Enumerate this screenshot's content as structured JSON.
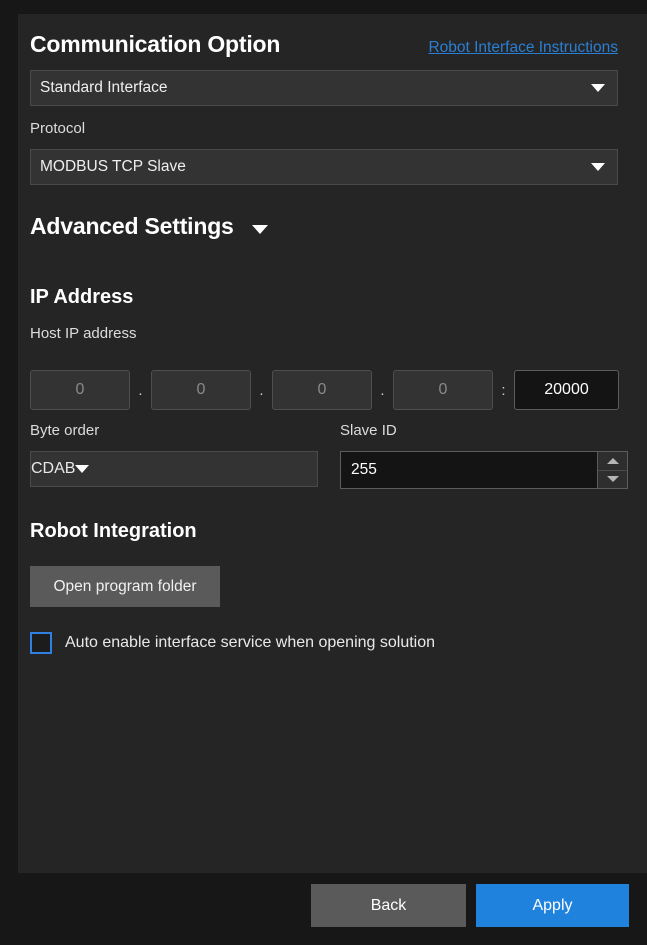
{
  "panel": {
    "header": {
      "title": "Communication Option",
      "link": "Robot Interface Instructions"
    },
    "interface_select": {
      "value": "Standard Interface"
    },
    "protocol": {
      "label": "Protocol",
      "value": "MODBUS TCP Slave"
    },
    "advanced_settings": {
      "title": "Advanced Settings"
    },
    "ip_address": {
      "title": "IP Address",
      "host_label": "Host IP address",
      "octets": [
        "0",
        "0",
        "0",
        "0"
      ],
      "separator": ".",
      "port_separator": ":",
      "port": "20000"
    },
    "byte_order": {
      "label": "Byte order",
      "value": "CDAB"
    },
    "slave_id": {
      "label": "Slave ID",
      "value": "255"
    },
    "robot_integration": {
      "title": "Robot Integration",
      "open_folder_label": "Open program folder"
    },
    "auto_enable": {
      "label": "Auto enable interface service when opening solution",
      "checked": false
    }
  },
  "footer": {
    "back_label": "Back",
    "apply_label": "Apply"
  },
  "colors": {
    "accent_blue": "#1f82dd",
    "link_blue": "#2a7fd4",
    "checkbox_blue": "#2f80e0",
    "panel_bg": "#252525",
    "window_bg": "#171717",
    "button_grey": "#5a5a5a"
  }
}
